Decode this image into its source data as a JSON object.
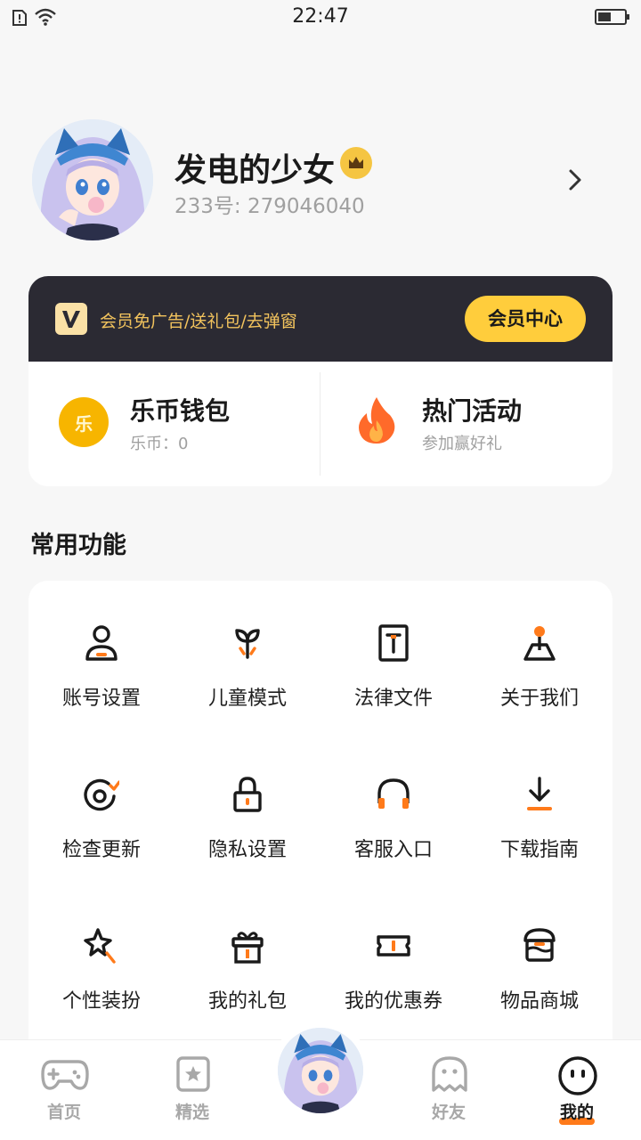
{
  "status_bar": {
    "time": "22:47"
  },
  "profile": {
    "name": "发电的少女",
    "id_text": "233号: 279046040"
  },
  "vip": {
    "promo": "会员免广告/送礼包/去弹窗",
    "button": "会员中心"
  },
  "wallet": {
    "title": "乐币钱包",
    "subtitle": "乐币：0",
    "coin_glyph": "乐"
  },
  "hot_activity": {
    "title": "热门活动",
    "subtitle": "参加赢好礼"
  },
  "section": {
    "title": "常用功能"
  },
  "features": [
    {
      "label": "账号设置",
      "icon": "user-icon"
    },
    {
      "label": "儿童模式",
      "icon": "sprout-icon"
    },
    {
      "label": "法律文件",
      "icon": "document-icon"
    },
    {
      "label": "关于我们",
      "icon": "location-pin-icon"
    },
    {
      "label": "检查更新",
      "icon": "refresh-icon"
    },
    {
      "label": "隐私设置",
      "icon": "lock-icon"
    },
    {
      "label": "客服入口",
      "icon": "headset-icon"
    },
    {
      "label": "下载指南",
      "icon": "download-icon"
    },
    {
      "label": "个性装扮",
      "icon": "magic-wand-icon"
    },
    {
      "label": "我的礼包",
      "icon": "gift-icon"
    },
    {
      "label": "我的优惠券",
      "icon": "ticket-icon"
    },
    {
      "label": "物品商城",
      "icon": "store-icon"
    }
  ],
  "tabs": [
    {
      "label": "首页",
      "icon": "gamepad-icon"
    },
    {
      "label": "精选",
      "icon": "star-bookmark-icon"
    },
    {
      "label": "好友",
      "icon": "ghost-icon"
    },
    {
      "label": "我的",
      "icon": "face-icon"
    }
  ],
  "colors": {
    "accent": "#ff7a1a",
    "vip_gold": "#ffcd3c",
    "vip_dark": "#2b2a33"
  }
}
